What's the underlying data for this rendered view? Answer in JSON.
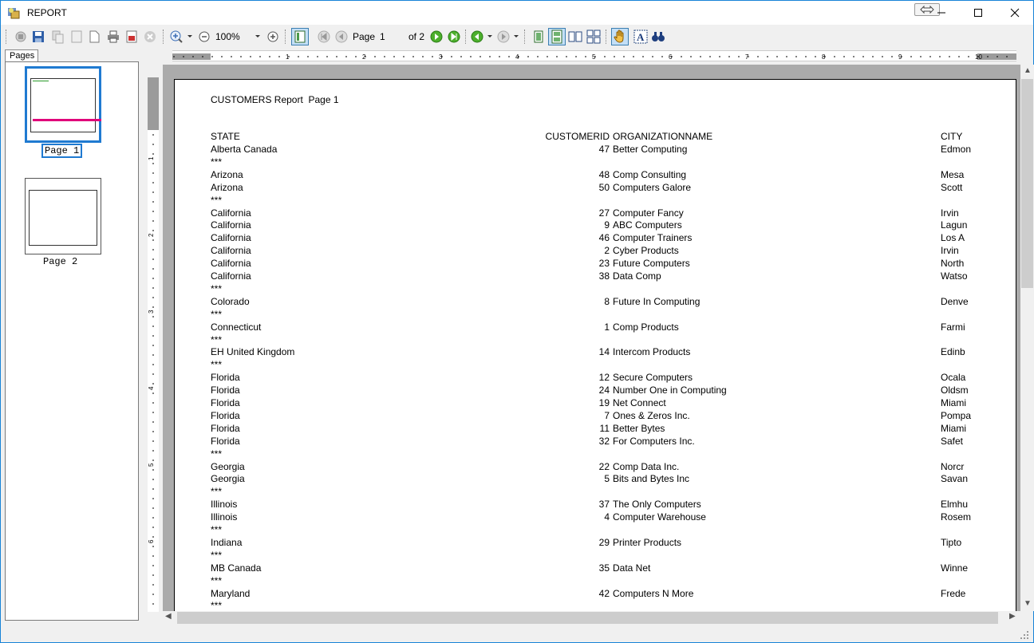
{
  "window": {
    "title": "REPORT"
  },
  "toolbar": {
    "zoom_value": "100%",
    "page_label": "Page",
    "page_value": "1",
    "of_label": "of 2"
  },
  "thumbnails": {
    "tab_label": "Pages",
    "pages": [
      {
        "label": "Page 1",
        "selected": true
      },
      {
        "label": "Page 2",
        "selected": false
      }
    ]
  },
  "ruler": {
    "h_numbers": [
      "1",
      "2",
      "3",
      "4",
      "5",
      "6",
      "7",
      "8",
      "9",
      "10"
    ],
    "v_numbers": [
      "1",
      "2",
      "3",
      "4",
      "5",
      "6"
    ]
  },
  "report": {
    "heading": "CUSTOMERS Report  Page 1",
    "columns": {
      "state": "STATE",
      "id": "CUSTOMERID",
      "org": "ORGANIZATIONNAME",
      "city": "CITY"
    },
    "rows": [
      {
        "state": "Alberta Canada",
        "id": "47",
        "org": "Better Computing",
        "city": "Edmon"
      },
      {
        "sep": "***"
      },
      {
        "state": "Arizona",
        "id": "48",
        "org": "Comp Consulting",
        "city": "Mesa"
      },
      {
        "state": "Arizona",
        "id": "50",
        "org": "Computers Galore",
        "city": "Scott"
      },
      {
        "sep": "***"
      },
      {
        "state": "California",
        "id": "27",
        "org": "Computer Fancy",
        "city": "Irvin"
      },
      {
        "state": "California",
        "id": "9",
        "org": "ABC Computers",
        "city": "Lagun"
      },
      {
        "state": "California",
        "id": "46",
        "org": "Computer Trainers",
        "city": "Los A"
      },
      {
        "state": "California",
        "id": "2",
        "org": "Cyber Products",
        "city": "Irvin"
      },
      {
        "state": "California",
        "id": "23",
        "org": "Future Computers",
        "city": "North"
      },
      {
        "state": "California",
        "id": "38",
        "org": "Data Comp",
        "city": "Watso"
      },
      {
        "sep": "***"
      },
      {
        "state": "Colorado",
        "id": "8",
        "org": "Future In Computing",
        "city": "Denve"
      },
      {
        "sep": "***"
      },
      {
        "state": "Connecticut",
        "id": "1",
        "org": "Comp Products",
        "city": "Farmi"
      },
      {
        "sep": "***"
      },
      {
        "state": "EH United Kingdom",
        "id": "14",
        "org": "Intercom Products",
        "city": "Edinb"
      },
      {
        "sep": "***"
      },
      {
        "state": "Florida",
        "id": "12",
        "org": "Secure Computers",
        "city": "Ocala"
      },
      {
        "state": "Florida",
        "id": "24",
        "org": "Number One in Computing",
        "city": "Oldsm"
      },
      {
        "state": "Florida",
        "id": "19",
        "org": "Net Connect",
        "city": "Miami"
      },
      {
        "state": "Florida",
        "id": "7",
        "org": "Ones & Zeros Inc.",
        "city": "Pompa"
      },
      {
        "state": "Florida",
        "id": "11",
        "org": "Better Bytes",
        "city": "Miami"
      },
      {
        "state": "Florida",
        "id": "32",
        "org": "For Computers Inc.",
        "city": "Safet"
      },
      {
        "sep": "***"
      },
      {
        "state": "Georgia",
        "id": "22",
        "org": "Comp Data Inc.",
        "city": "Norcr"
      },
      {
        "state": "Georgia",
        "id": "5",
        "org": "Bits and Bytes Inc",
        "city": "Savan"
      },
      {
        "sep": "***"
      },
      {
        "state": "Illinois",
        "id": "37",
        "org": "The Only Computers",
        "city": "Elmhu"
      },
      {
        "state": "Illinois",
        "id": "4",
        "org": "Computer Warehouse",
        "city": "Rosem"
      },
      {
        "sep": "***"
      },
      {
        "state": "Indiana",
        "id": "29",
        "org": "Printer Products",
        "city": "Tipto"
      },
      {
        "sep": "***"
      },
      {
        "state": "MB Canada",
        "id": "35",
        "org": "Data Net",
        "city": "Winne"
      },
      {
        "sep": "***"
      },
      {
        "state": "Maryland",
        "id": "42",
        "org": "Computers N More",
        "city": "Frede"
      },
      {
        "sep": "***"
      }
    ]
  },
  "colors": {
    "accent": "#1f7ad1",
    "highlight_pink": "#e0007a",
    "viewer_bg": "#ababab"
  }
}
